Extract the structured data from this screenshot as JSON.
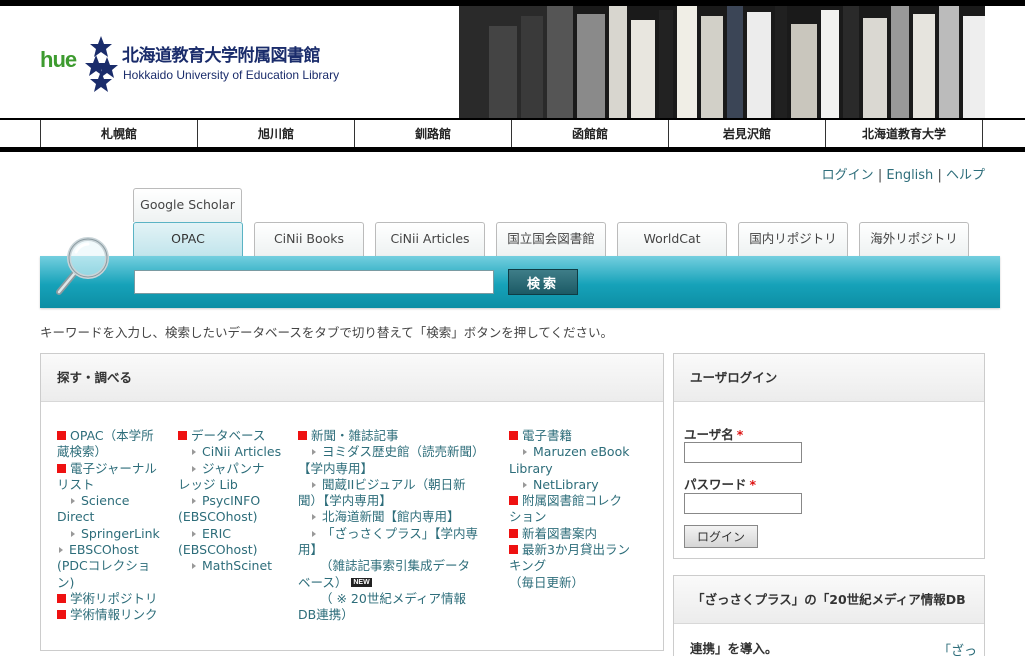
{
  "header": {
    "logo_mark": "hue",
    "title_ja": "北海道教育大学附属図書館",
    "title_en": "Hokkaido University of Education Library"
  },
  "nav": {
    "items": [
      "札幌館",
      "旭川館",
      "釧路館",
      "函館館",
      "岩見沢館",
      "北海道教育大学"
    ]
  },
  "util": {
    "login": "ログイン",
    "english": "English",
    "help": "ヘルプ",
    "separator": "|"
  },
  "tabs": {
    "top": "Google Scholar",
    "items": [
      "OPAC",
      "CiNii Books",
      "CiNii Articles",
      "国立国会図書館",
      "WorldCat",
      "国内リポジトリ",
      "海外リポジトリ"
    ],
    "active": "OPAC"
  },
  "search": {
    "value": "",
    "button": "検索"
  },
  "instructions": "キーワードを入力し、検索したいデータベースをタブで切り替えて「検索」ボタンを押してください。",
  "explore": {
    "title": "探す・調べる",
    "col1": {
      "opac_1": "OPAC（本学所",
      "opac_2": "蔵検索）",
      "ej_1": "電子ジャーナル",
      "ej_2": "リスト",
      "sd_1": "Science",
      "sd_2": "Direct",
      "springer": "SpringerLink",
      "ebsco_1": "EBSCOhost",
      "ebsco_2": "(PDCコレクショ",
      "ebsco_3": "ン)",
      "repo": "学術リポジトリ",
      "links": "学術情報リンク"
    },
    "col2": {
      "db": "データベース",
      "cinii": "CiNii Articles",
      "jk_1": "ジャパンナ",
      "jk_2": "レッジ Lib",
      "psyc_1": "PsycINFO",
      "psyc_2": "(EBSCOhost)",
      "eric_1": "ERIC",
      "eric_2": "(EBSCOhost)",
      "math": "MathScinet"
    },
    "col3": {
      "news": "新聞・雑誌記事",
      "yomi_1": "ヨミダス歴史館（読売新聞）",
      "yomi_2": "【学内専用】",
      "asahi_1": "聞蔵IIビジュアル（朝日新",
      "asahi_2": "聞）【学内専用】",
      "hokkaido": "北海道新聞【館内専用】",
      "zassaku_1": "「ざっさくプラス」【学内専",
      "zassaku_2": "用】",
      "zindex_1": "（雑誌記事索引集成データ",
      "zindex_2": "ベース）",
      "new_badge": "NEW",
      "media_1": "（ ※ 20世紀メディア情報",
      "media_2": "DB連携）"
    },
    "col4": {
      "ebook": "電子書籍",
      "maruzen_1": "Maruzen eBook",
      "maruzen_2": "Library",
      "netlib": "NetLibrary",
      "coll_1": "附属図書館コレク",
      "coll_2": "ション",
      "newbooks": "新着図書案内",
      "rank_1": "最新3か月貸出ラン",
      "rank_2": "キング",
      "rank_3": "（毎日更新）"
    }
  },
  "login": {
    "title": "ユーザログイン",
    "username": "ユーザ名",
    "password": "パスワード",
    "required": "*",
    "button": "ログイン"
  },
  "promo": {
    "title": "「ざっさくプラス」の「20世紀メディア情報DB",
    "line": "連携」を導入。",
    "fragment": "「ざっ"
  },
  "colors": {
    "accent": "#16a2b9",
    "link": "#2d6d7a",
    "bullet": "#e11111"
  }
}
